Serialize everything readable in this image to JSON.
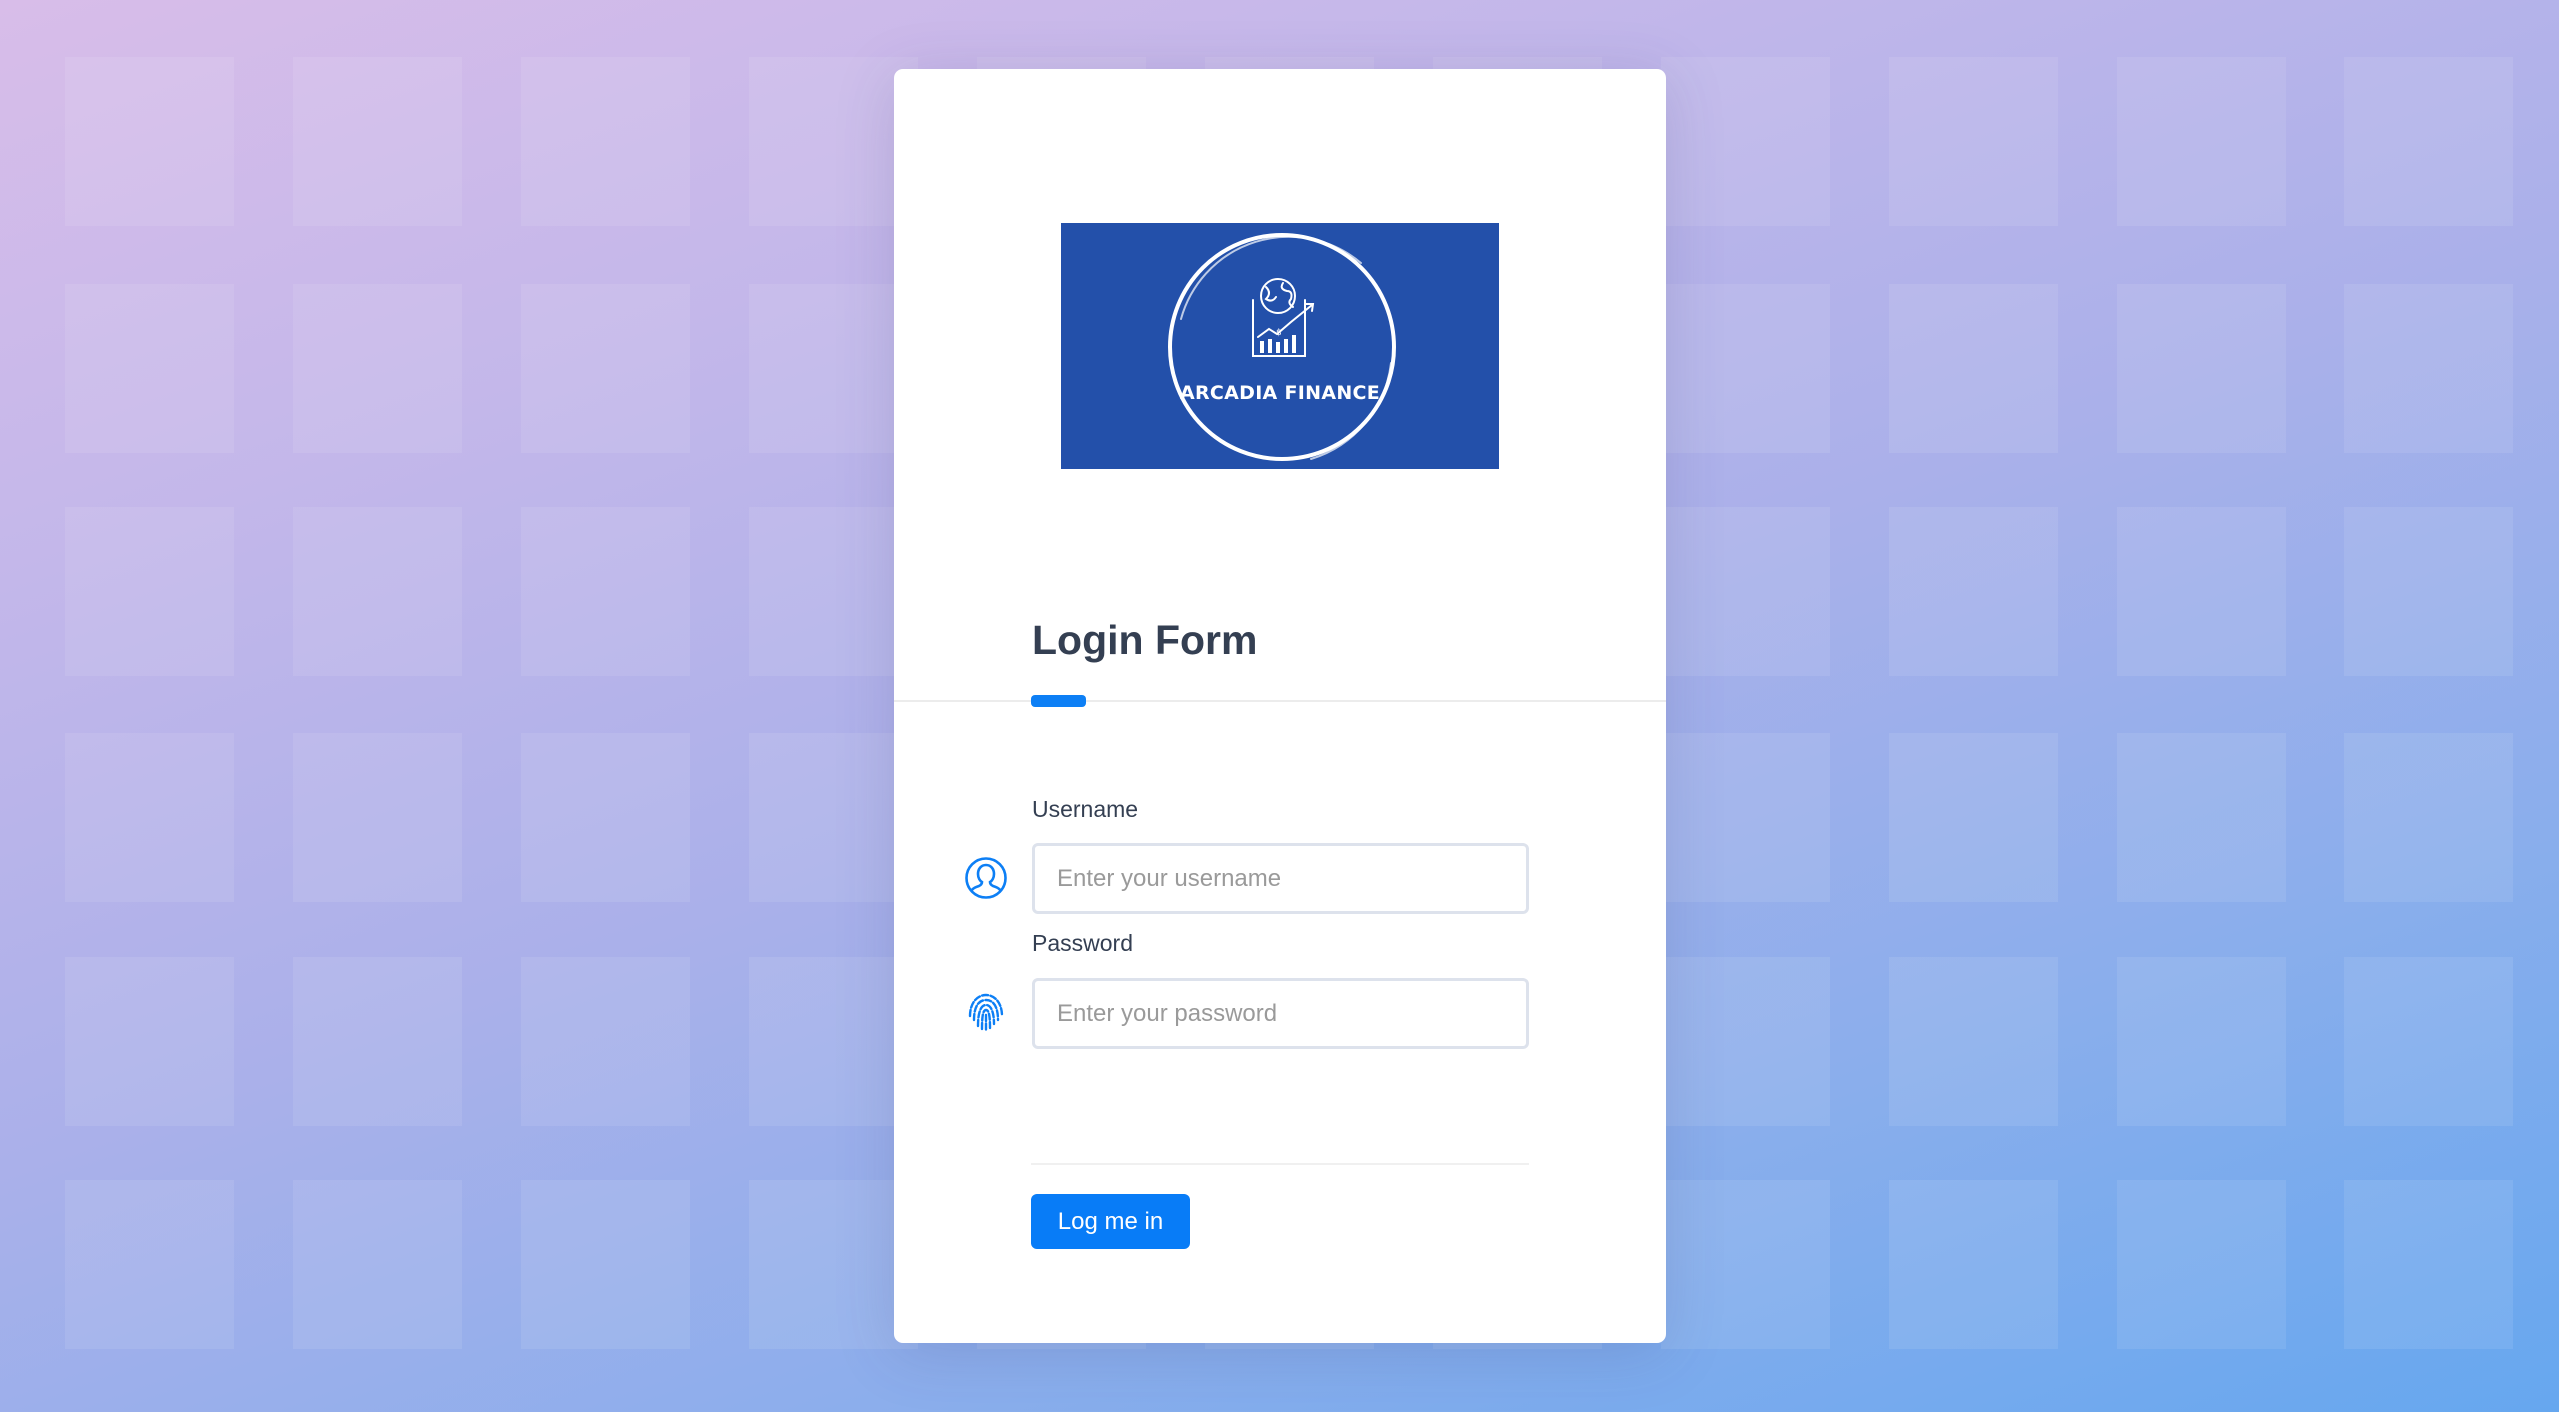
{
  "brand": {
    "logo_text": "ARCADIA FINANCE",
    "logo_bg_color": "#2350aa"
  },
  "form": {
    "title": "Login Form",
    "accent_color": "#0d7ff5",
    "fields": [
      {
        "label": "Username",
        "placeholder": "Enter your username",
        "value": "",
        "icon": "user-circle-icon",
        "type": "text"
      },
      {
        "label": "Password",
        "placeholder": "Enter your password",
        "value": "",
        "icon": "fingerprint-icon",
        "type": "password"
      }
    ],
    "submit_label": "Log me in",
    "submit_color": "#087cf7"
  }
}
